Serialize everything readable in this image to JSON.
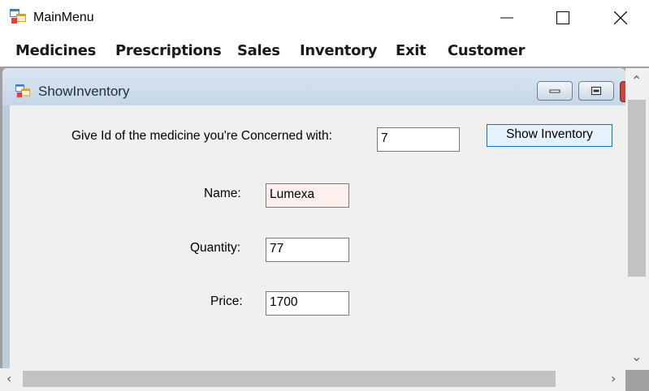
{
  "window": {
    "title": "MainMenu",
    "icon": "app-form-icon",
    "controls": [
      "minimize-icon",
      "maximize-icon",
      "close-icon"
    ]
  },
  "menu": {
    "items": [
      "Medicines",
      "Prescriptions",
      "Sales",
      "Inventory",
      "Exit",
      "Customer"
    ]
  },
  "child": {
    "title": "ShowInventory",
    "icon": "app-form-icon"
  },
  "form": {
    "prompt_label": "Give Id of the medicine you're Concerned with:",
    "id_value": "7",
    "show_button": "Show Inventory",
    "name_label": "Name:",
    "name_value": "Lumexa",
    "quantity_label": "Quantity:",
    "quantity_value": "77",
    "price_label": "Price:",
    "price_value": "1700"
  },
  "colors": {
    "accent_border": "#0078d7",
    "button_bg": "#e5f1fb",
    "highlight_field_bg": "#fdf0ec"
  }
}
